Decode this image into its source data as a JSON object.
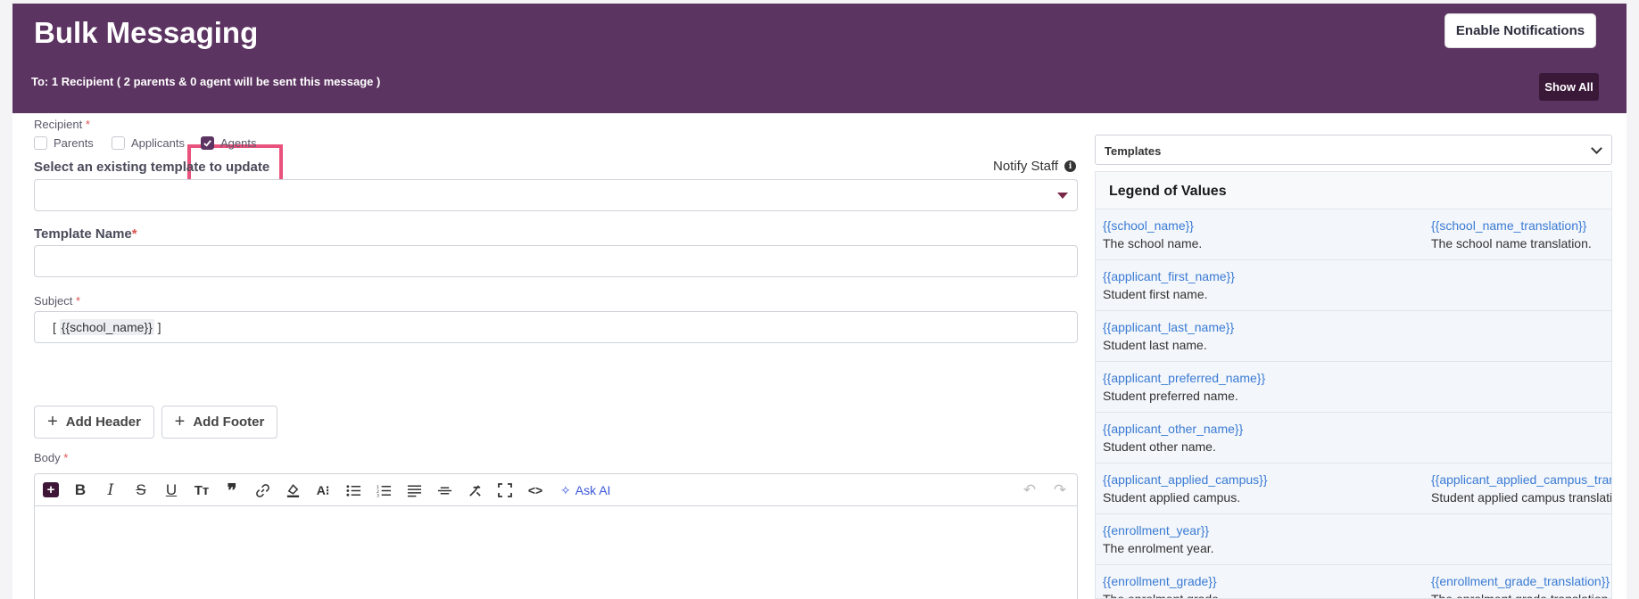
{
  "header": {
    "title": "Bulk Messaging",
    "to_text": "To: 1 Recipient ( 2 parents & 0 agent will be sent this message )",
    "enable_notifications": "Enable Notifications",
    "show_all": "Show All"
  },
  "form": {
    "recipient_label": "Recipient",
    "required_mark": "*",
    "recipients": [
      {
        "label": "Parents",
        "checked": false
      },
      {
        "label": "Applicants",
        "checked": false
      },
      {
        "label": "Agents",
        "checked": true
      }
    ],
    "notify_staff": "Notify Staff",
    "select_template_label": "Select an existing template to update",
    "template_name_label": "Template Name",
    "subject_label": "Subject",
    "subject_prefix": "[",
    "subject_token": "{{school_name}}",
    "subject_suffix": "]",
    "add_header": "Add Header",
    "add_footer": "Add Footer",
    "body_label": "Body",
    "ask_ai": "Ask AI"
  },
  "templates": {
    "select_label": "Templates",
    "legend_title": "Legend of Values",
    "rows": [
      {
        "v1": "{{school_name}}",
        "d1": "The school name.",
        "v2": "{{school_name_translation}}",
        "d2": "The school name translation."
      },
      {
        "v1": "{{applicant_first_name}}",
        "d1": "Student first name.",
        "v2": "",
        "d2": ""
      },
      {
        "v1": "{{applicant_last_name}}",
        "d1": "Student last name.",
        "v2": "",
        "d2": ""
      },
      {
        "v1": "{{applicant_preferred_name}}",
        "d1": "Student preferred name.",
        "v2": "",
        "d2": ""
      },
      {
        "v1": "{{applicant_other_name}}",
        "d1": "Student other name.",
        "v2": "",
        "d2": ""
      },
      {
        "v1": "{{applicant_applied_campus}}",
        "d1": "Student applied campus.",
        "v2": "{{applicant_applied_campus_tran",
        "d2": "Student applied campus translati"
      },
      {
        "v1": "{{enrollment_year}}",
        "d1": "The enrolment year.",
        "v2": "",
        "d2": ""
      },
      {
        "v1": "{{enrollment_grade}}",
        "d1": "The enrolment grade.",
        "v2": "{{enrollment_grade_translation}}",
        "d2": "The enrolment grade translation."
      }
    ]
  }
}
